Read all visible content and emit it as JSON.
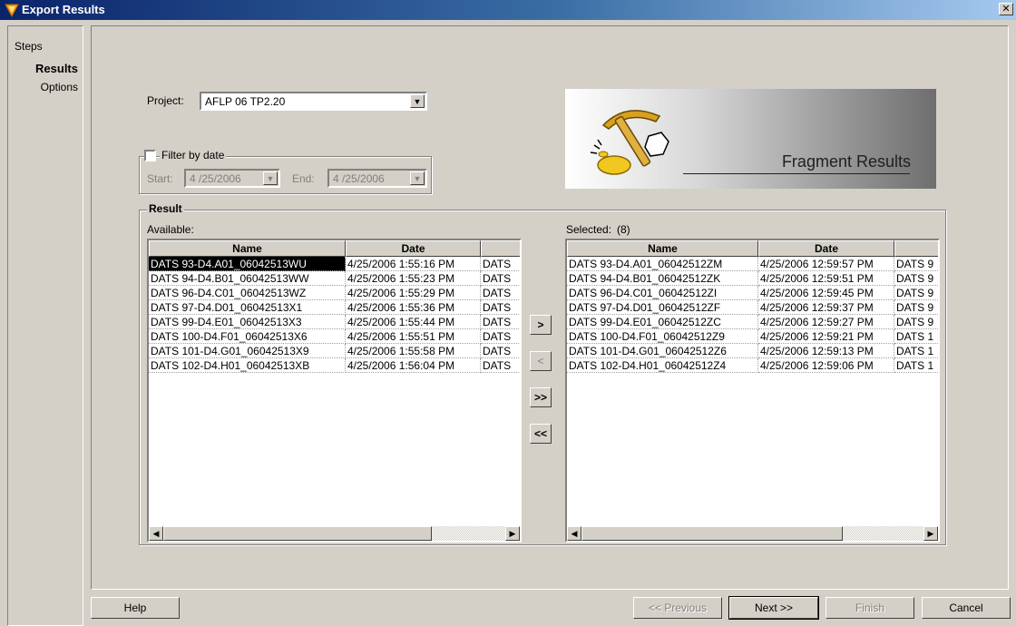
{
  "window": {
    "title": "Export Results",
    "close_glyph": "✕"
  },
  "steps": {
    "legend": "Steps",
    "items": [
      {
        "label": "Results",
        "active": true
      },
      {
        "label": "Options",
        "active": false
      }
    ]
  },
  "project": {
    "label": "Project:",
    "value": "AFLP 06 TP2.20"
  },
  "filter": {
    "label": "Filter by date",
    "checked": false,
    "start_label": "Start:",
    "start_value": "4 /25/2006",
    "end_label": "End:",
    "end_value": "4 /25/2006"
  },
  "banner": {
    "title": "Fragment Results",
    "icon": "pickaxe-gold-icon"
  },
  "result": {
    "legend": "Result",
    "available_label": "Available:",
    "selected_label": "Selected:",
    "selected_count": "(8)",
    "columns": [
      "Name",
      "Date",
      ""
    ],
    "available_rows": [
      {
        "name": "DATS 93-D4.A01_06042513WU",
        "date": "4/25/2006 1:55:16 PM",
        "extra": "DATS"
      },
      {
        "name": "DATS 94-D4.B01_06042513WW",
        "date": "4/25/2006 1:55:23 PM",
        "extra": "DATS"
      },
      {
        "name": "DATS 96-D4.C01_06042513WZ",
        "date": "4/25/2006 1:55:29 PM",
        "extra": "DATS"
      },
      {
        "name": "DATS 97-D4.D01_06042513X1",
        "date": "4/25/2006 1:55:36 PM",
        "extra": "DATS"
      },
      {
        "name": "DATS 99-D4.E01_06042513X3",
        "date": "4/25/2006 1:55:44 PM",
        "extra": "DATS"
      },
      {
        "name": "DATS 100-D4.F01_06042513X6",
        "date": "4/25/2006 1:55:51 PM",
        "extra": "DATS"
      },
      {
        "name": "DATS 101-D4.G01_06042513X9",
        "date": "4/25/2006 1:55:58 PM",
        "extra": "DATS"
      },
      {
        "name": "DATS 102-D4.H01_06042513XB",
        "date": "4/25/2006 1:56:04 PM",
        "extra": "DATS"
      }
    ],
    "selected_rows": [
      {
        "name": "DATS 93-D4.A01_06042512ZM",
        "date": "4/25/2006 12:59:57 PM",
        "extra": "DATS 9"
      },
      {
        "name": "DATS 94-D4.B01_06042512ZK",
        "date": "4/25/2006 12:59:51 PM",
        "extra": "DATS 9"
      },
      {
        "name": "DATS 96-D4.C01_06042512ZI",
        "date": "4/25/2006 12:59:45 PM",
        "extra": "DATS 9"
      },
      {
        "name": "DATS 97-D4.D01_06042512ZF",
        "date": "4/25/2006 12:59:37 PM",
        "extra": "DATS 9"
      },
      {
        "name": "DATS 99-D4.E01_06042512ZC",
        "date": "4/25/2006 12:59:27 PM",
        "extra": "DATS 9"
      },
      {
        "name": "DATS 100-D4.F01_06042512Z9",
        "date": "4/25/2006 12:59:21 PM",
        "extra": "DATS 1"
      },
      {
        "name": "DATS 101-D4.G01_06042512Z6",
        "date": "4/25/2006 12:59:13 PM",
        "extra": "DATS 1"
      },
      {
        "name": "DATS 102-D4.H01_06042512Z4",
        "date": "4/25/2006 12:59:06 PM",
        "extra": "DATS 1"
      }
    ],
    "move_buttons": {
      "add": ">",
      "remove": "<",
      "add_all": ">>",
      "remove_all": "<<"
    }
  },
  "footer": {
    "help": "Help",
    "previous": "<< Previous",
    "next": "Next >>",
    "finish": "Finish",
    "cancel": "Cancel"
  }
}
